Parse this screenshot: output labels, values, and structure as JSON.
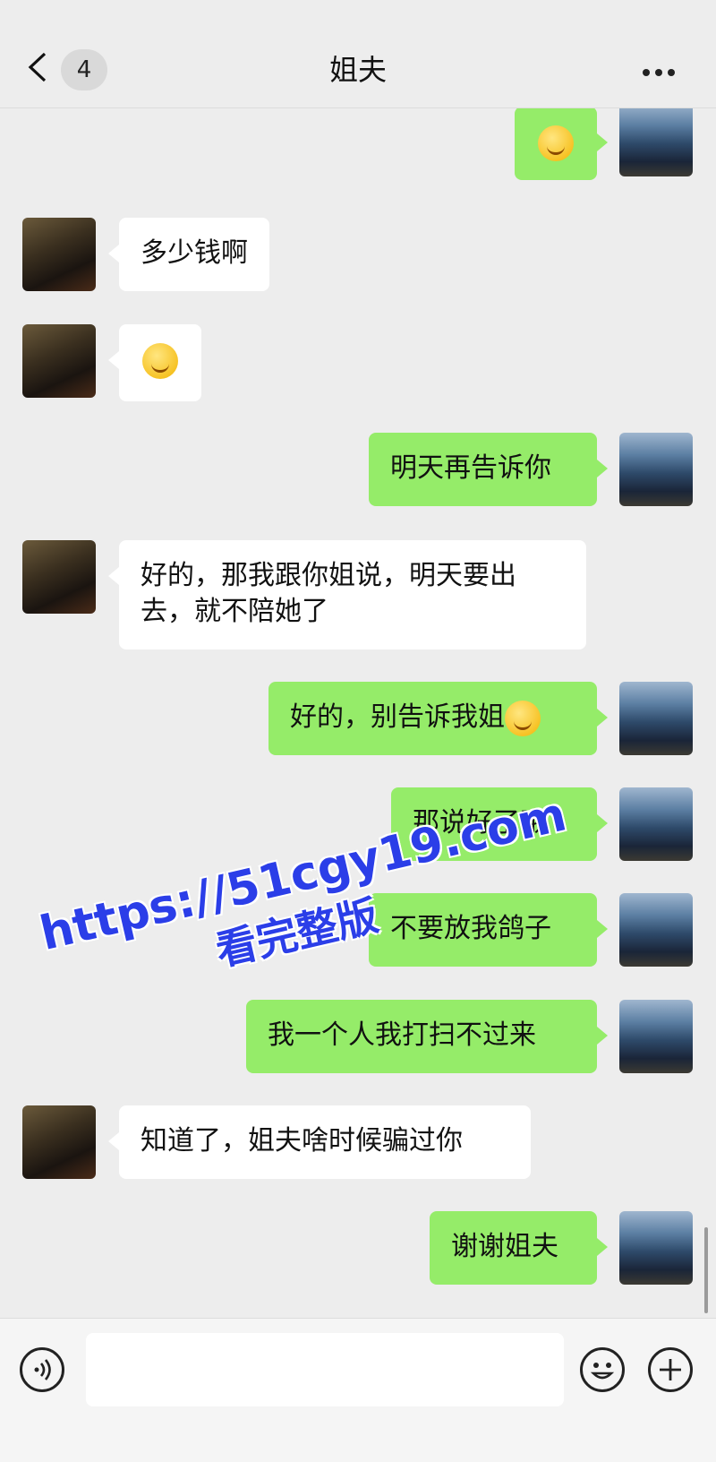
{
  "header": {
    "back_icon": "chevron-left-icon",
    "unread_count": "4",
    "title": "姐夫",
    "more_icon": "more-dots-icon"
  },
  "messages": [
    {
      "side": "right",
      "text": "",
      "emoji": "squinting-grin"
    },
    {
      "side": "left",
      "text": "多少钱啊",
      "emoji": ""
    },
    {
      "side": "left",
      "text": "",
      "emoji": "confused-face"
    },
    {
      "side": "right",
      "text": "明天再告诉你",
      "emoji": ""
    },
    {
      "side": "left",
      "text": "好的，那我跟你姐说，明天要出去，就不陪她了",
      "emoji": ""
    },
    {
      "side": "right",
      "text": "好的，别告诉我姐",
      "emoji": "grinning-face"
    },
    {
      "side": "right",
      "text": "那说好了哦",
      "emoji": ""
    },
    {
      "side": "right",
      "text": "不要放我鸽子",
      "emoji": ""
    },
    {
      "side": "right",
      "text": "我一个人我打扫不过来",
      "emoji": ""
    },
    {
      "side": "left",
      "text": "知道了，姐夫啥时候骗过你",
      "emoji": ""
    },
    {
      "side": "right",
      "text": "谢谢姐夫",
      "emoji": ""
    }
  ],
  "watermark": {
    "line1": "https://51cgy19.com",
    "line2": "看完整版"
  },
  "footer": {
    "voice_icon": "voice-icon",
    "emoji_icon": "emoji-icon",
    "plus_icon": "plus-icon",
    "input_value": ""
  }
}
